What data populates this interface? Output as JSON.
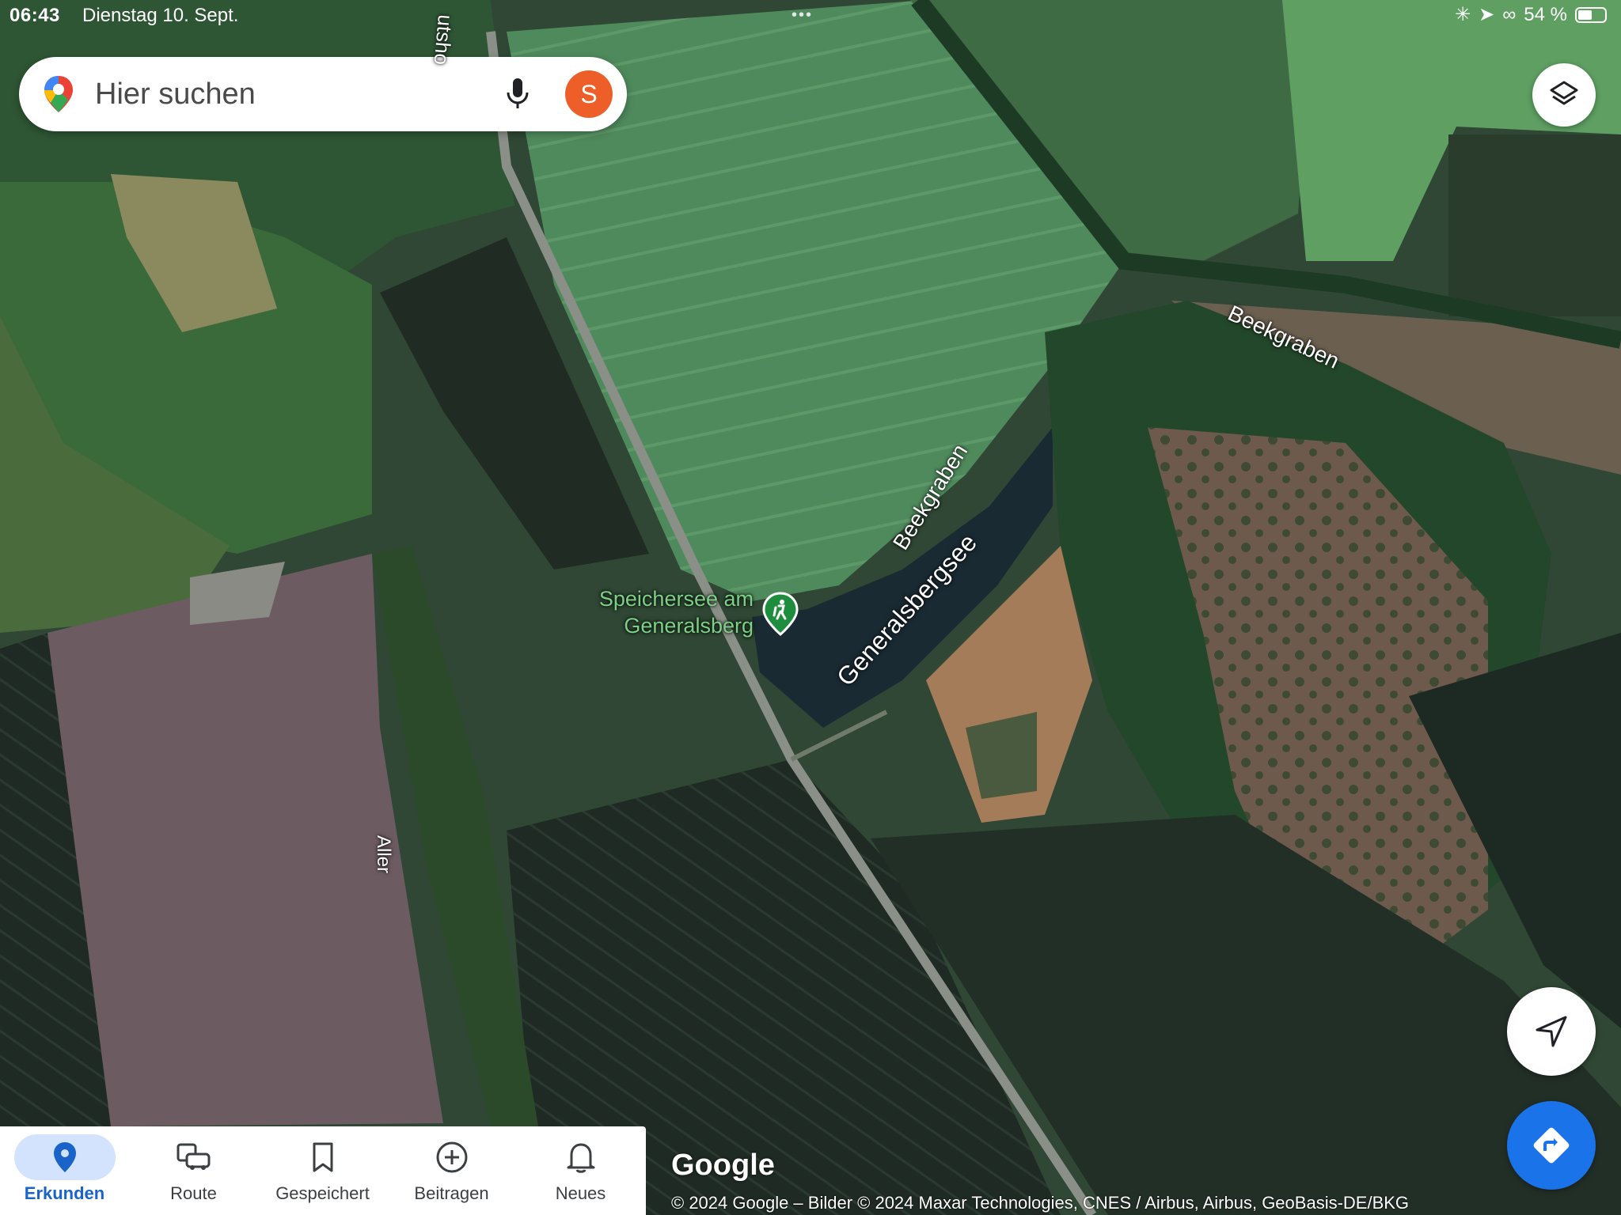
{
  "status_bar": {
    "time": "06:43",
    "date": "Dienstag 10. Sept.",
    "battery": "54 %",
    "battery_level": 0.54
  },
  "search": {
    "placeholder": "Hier suchen",
    "avatar_letter": "S",
    "avatar_color": "#ee5e28"
  },
  "map": {
    "labels": {
      "road_top": "utsho",
      "beekgraben_right": "Beekgraben",
      "beekgraben_lake": "Beekgraben",
      "lake": "Generalsbergsee",
      "river": "Aller"
    },
    "poi": {
      "name_line1": "Speichersee am",
      "name_line2": "Generalsberg",
      "icon": "hiking-icon",
      "color": "#1e8e3e"
    },
    "logo": "Google",
    "attribution": "© 2024 Google – Bilder © 2024 Maxar Technologies, CNES / Airbus, Airbus, GeoBasis-DE/BKG"
  },
  "nav": {
    "items": [
      {
        "label": "Erkunden",
        "icon": "location-pin-icon",
        "active": true
      },
      {
        "label": "Route",
        "icon": "commute-icon",
        "active": false
      },
      {
        "label": "Gespeichert",
        "icon": "bookmark-icon",
        "active": false
      },
      {
        "label": "Beitragen",
        "icon": "add-circle-icon",
        "active": false
      },
      {
        "label": "Neues",
        "icon": "bell-icon",
        "active": false
      }
    ]
  },
  "colors": {
    "accent": "#1a73e8",
    "nav_active_bg": "#d3e3fd"
  }
}
